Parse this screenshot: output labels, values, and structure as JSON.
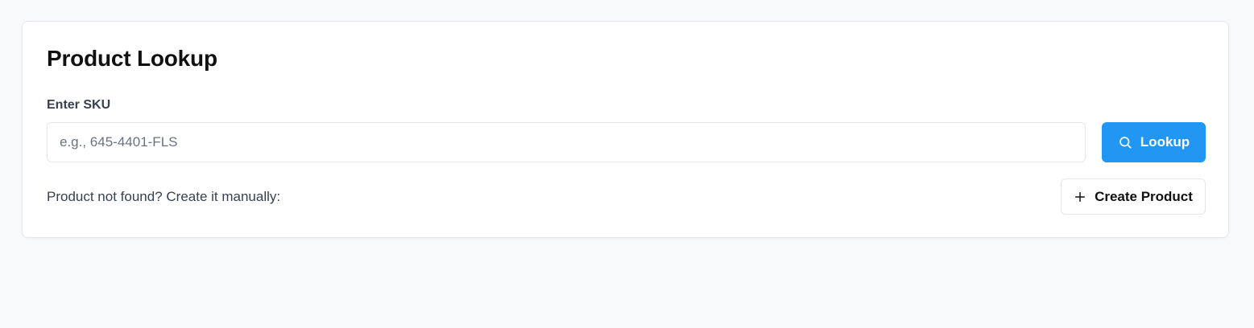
{
  "card": {
    "title": "Product Lookup",
    "sku_label": "Enter SKU",
    "sku_input": {
      "value": "",
      "placeholder": "e.g., 645-4401-FLS"
    },
    "lookup_button": {
      "label": "Lookup",
      "icon": "search-icon",
      "color": "#2196f3"
    },
    "helper_text": "Product not found? Create it manually:",
    "create_button": {
      "label": "Create Product",
      "icon": "plus-icon"
    }
  }
}
